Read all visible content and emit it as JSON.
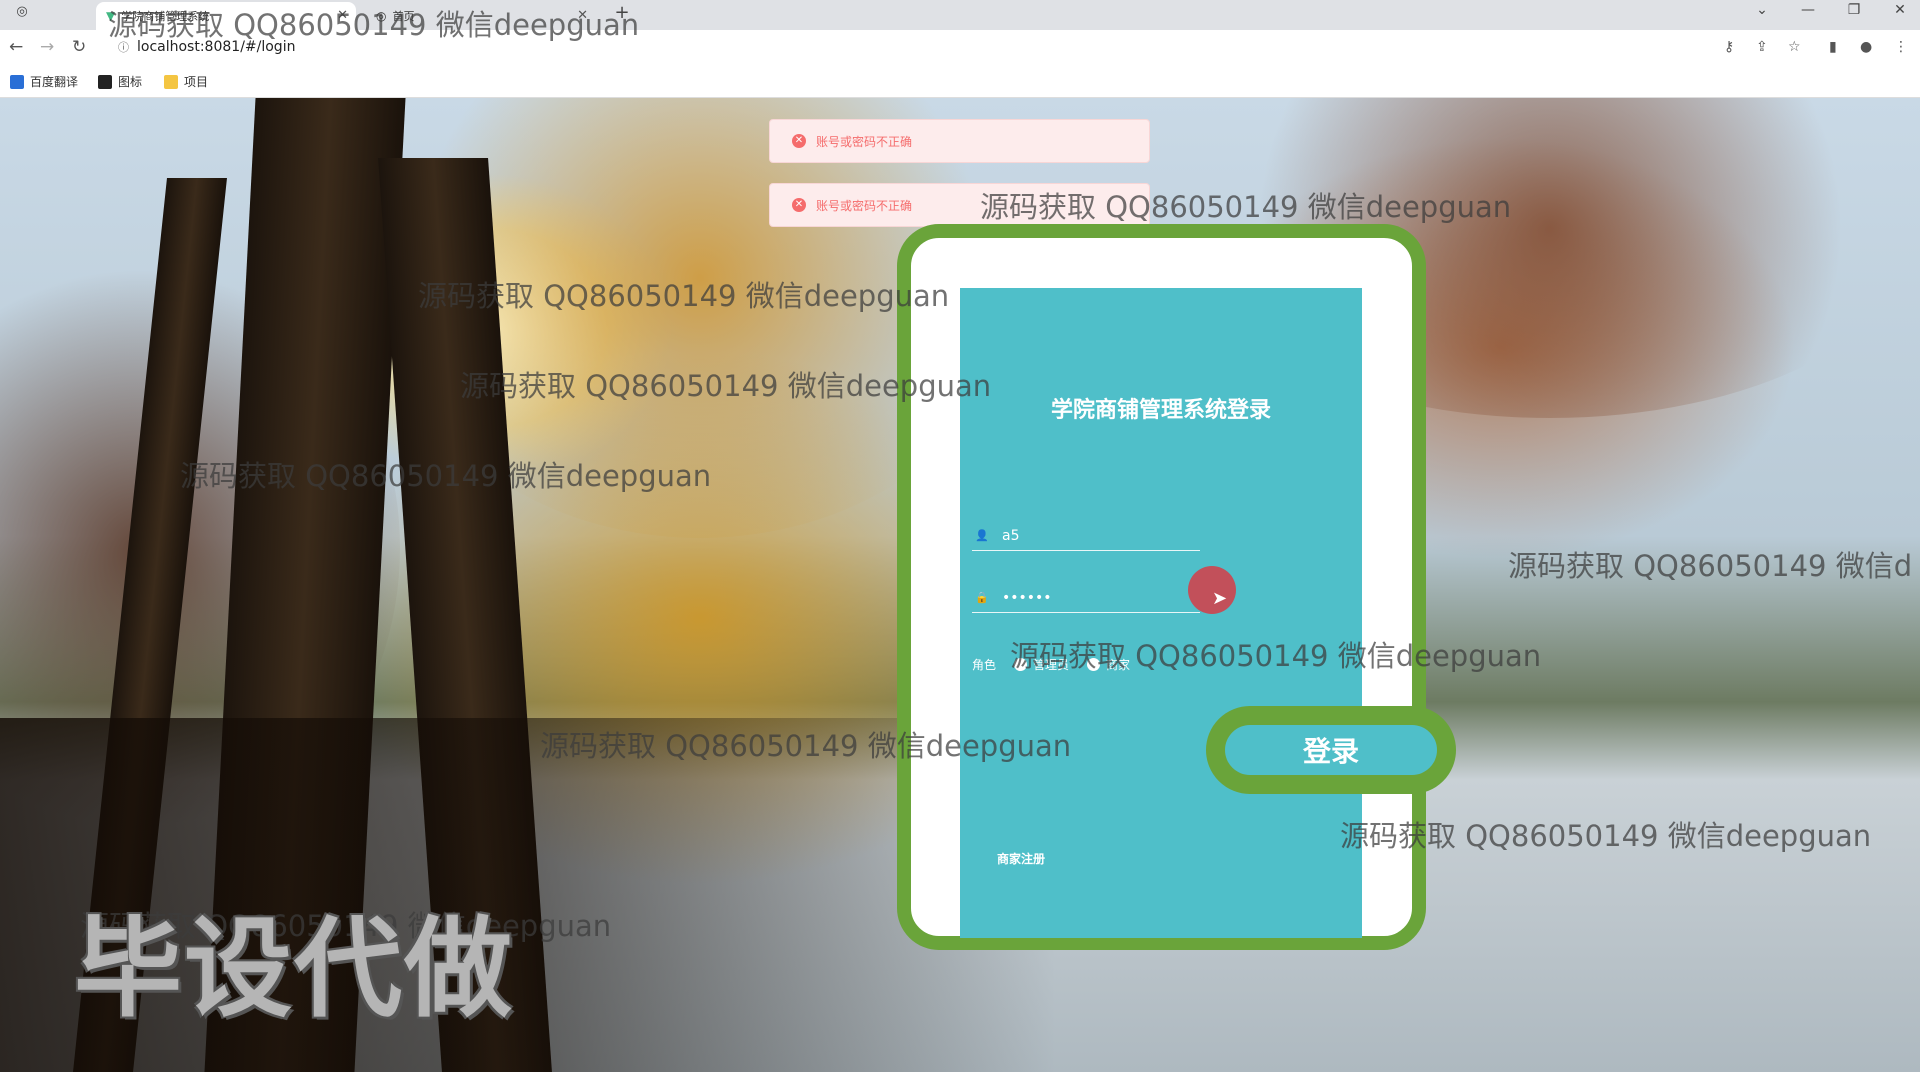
{
  "browser": {
    "tabs": [
      {
        "label": ""
      },
      {
        "label": "学院商铺管理系统"
      },
      {
        "label": "首页"
      }
    ],
    "new_tab": "+",
    "window_controls": [
      "⌄",
      "—",
      "❐",
      "✕"
    ],
    "url": "localhost:8081/#/login",
    "bookmarks": [
      {
        "label": "百度翻译",
        "color": "#2a6fd6"
      },
      {
        "label": "图标",
        "color": "#222222"
      },
      {
        "label": "项目",
        "color": "#f4c542"
      }
    ]
  },
  "toasts": [
    {
      "message": "账号或密码不正确"
    },
    {
      "message": "账号或密码不正确"
    }
  ],
  "login": {
    "title": "学院商铺管理系统登录",
    "username_value": "a5",
    "password_value": "••••••",
    "role_label": "角色",
    "roles": [
      {
        "label": "管理员"
      },
      {
        "label": "商家"
      }
    ],
    "submit_label": "登录",
    "register_label": "商家注册"
  },
  "watermarks": [
    "源码获取 QQ86050149 微信deepguan",
    "源码获取 QQ86050149 微信deepguan",
    "源码获取 QQ86050149 微信deepguan",
    "源码获取 QQ86050149 微信deepguan",
    "源码获取 QQ86050149 微信deepguan",
    "源码获取 QQ86050149 微信deepguan",
    "源码获取 QQ86050149 微信deepguan",
    "源码获取 QQ86050149 微信deepguan",
    "源码获取 QQ86050149 微信deepguan",
    "源码获取 QQ86050149 微信d"
  ],
  "big_watermark": "毕设代做",
  "colors": {
    "panel": "#4fbfc9",
    "frame": "#6aa43a",
    "error": "#f56c6c"
  }
}
